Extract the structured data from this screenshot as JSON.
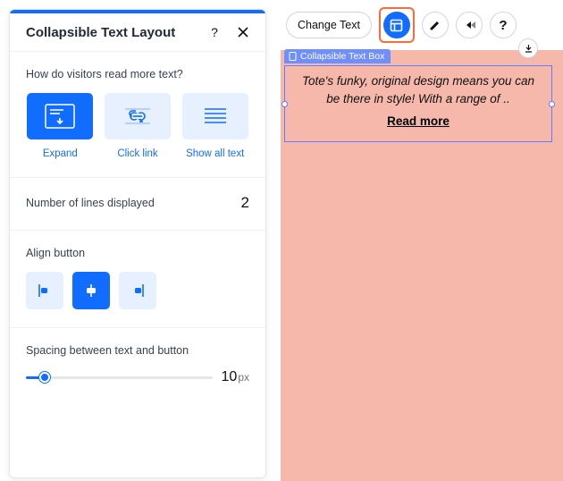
{
  "panel": {
    "title": "Collapsible Text Layout",
    "sections": {
      "readMode": {
        "label": "How do visitors read more text?",
        "options": [
          "Expand",
          "Click link",
          "Show all text"
        ]
      },
      "lines": {
        "label": "Number of lines displayed",
        "value": "2"
      },
      "align": {
        "label": "Align button"
      },
      "spacing": {
        "label": "Spacing between text and button",
        "value": "10",
        "unit": "px"
      }
    }
  },
  "toolbar": {
    "changeText": "Change Text"
  },
  "component": {
    "badge": "Collapsible Text Box",
    "preview": "Tote's funky, original design means you can be there in style! With a range of ..",
    "readMore": "Read more"
  }
}
